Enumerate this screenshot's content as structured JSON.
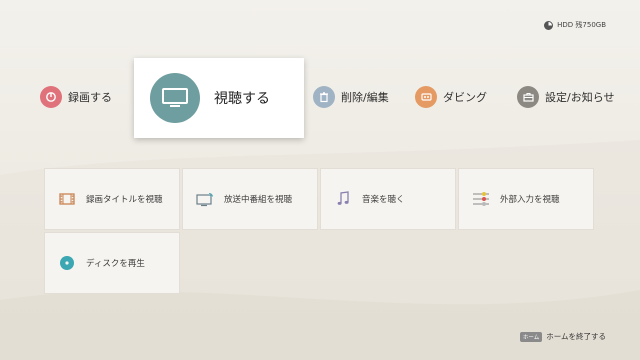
{
  "status": {
    "hdd_label": "HDD 残750GB"
  },
  "top_menu": {
    "items": [
      {
        "label": "録画する",
        "icon": "record-icon",
        "color": "#e0727b"
      },
      {
        "label": "視聴する",
        "icon": "tv-icon",
        "color": "#6f9ea0",
        "selected": true
      },
      {
        "label": "削除/編集",
        "icon": "trash-icon",
        "color": "#9fb3c4"
      },
      {
        "label": "ダビング",
        "icon": "dubbing-icon",
        "color": "#e49a62"
      },
      {
        "label": "設定/お知らせ",
        "icon": "toolbox-icon",
        "color": "#8c8983"
      }
    ]
  },
  "tiles": [
    {
      "label": "録画タイトルを視聴",
      "icon": "film-icon"
    },
    {
      "label": "放送中番組を視聴",
      "icon": "broadcast-tv-icon"
    },
    {
      "label": "音楽を聴く",
      "icon": "music-note-icon"
    },
    {
      "label": "外部入力を視聴",
      "icon": "av-cable-icon"
    },
    {
      "label": "ディスクを再生",
      "icon": "disc-icon"
    }
  ],
  "footer": {
    "key_label": "ホーム",
    "action_label": "ホームを終了する"
  }
}
